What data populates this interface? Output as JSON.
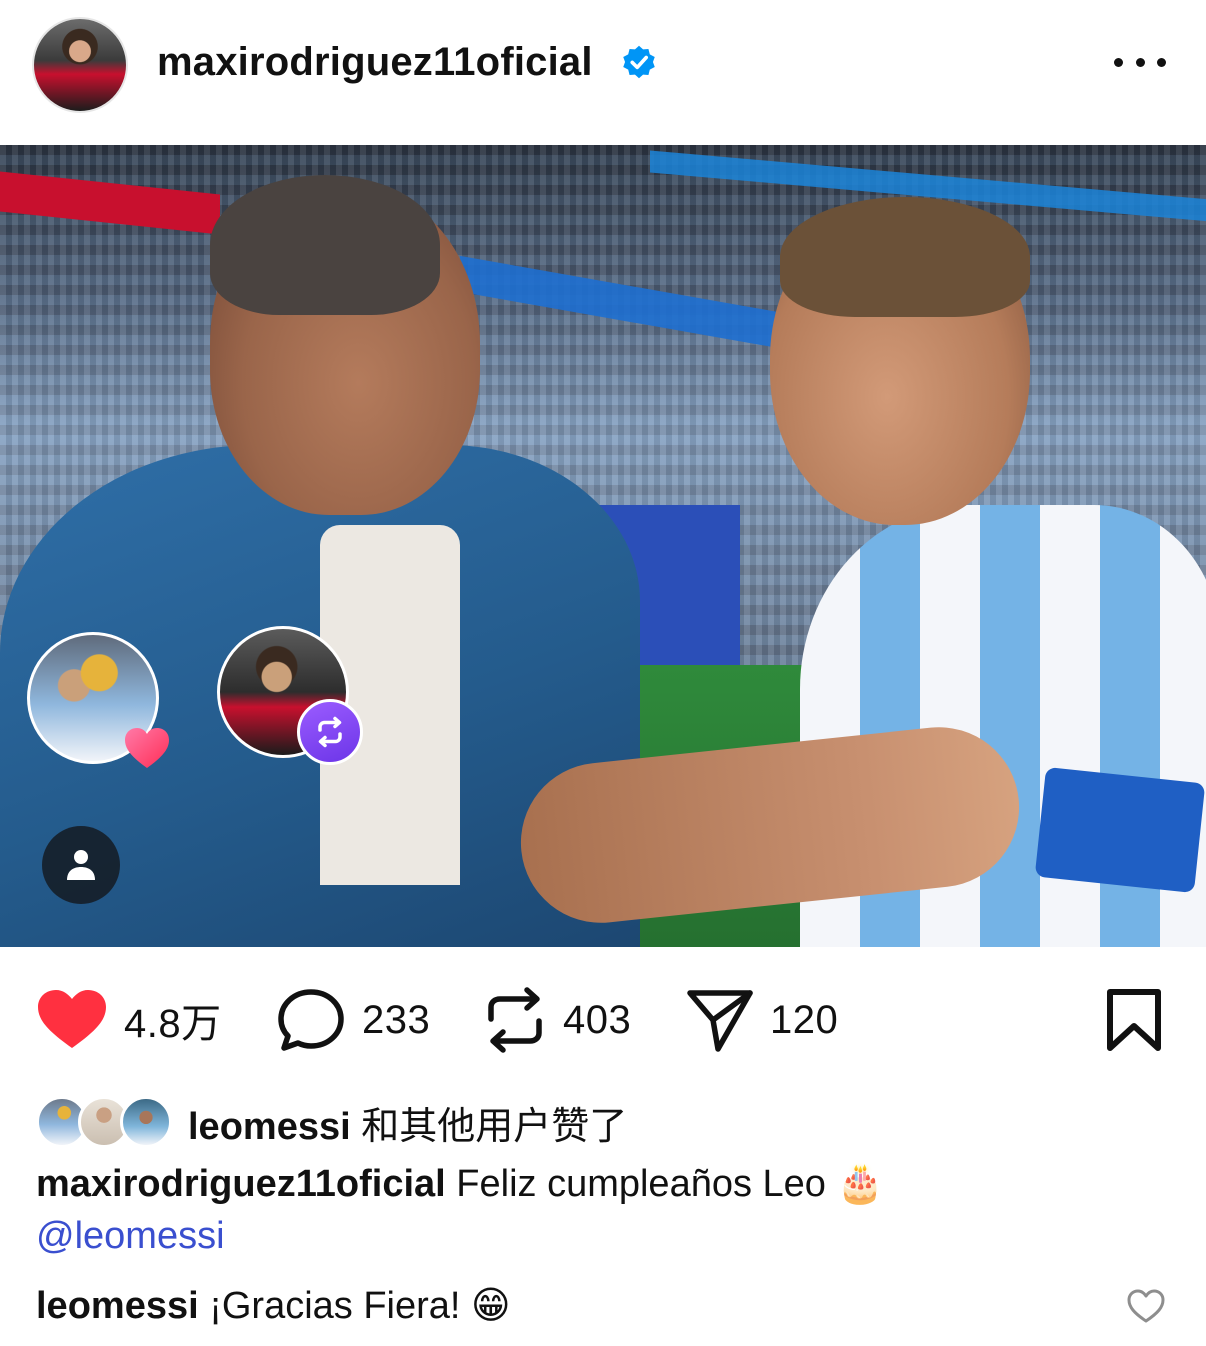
{
  "post": {
    "username": "maxirodriguez11oficial",
    "verified": true,
    "more_icon": "more-horizontal-icon"
  },
  "photo": {
    "tag_icon": "person-icon",
    "repost_icon": "repost-icon",
    "reaction_icon": "heart-icon"
  },
  "actions": {
    "likes": "4.8万",
    "comments": "233",
    "reposts": "403",
    "shares": "120"
  },
  "liked_by": {
    "user": "leomessi",
    "suffix": " 和其他用户赞了"
  },
  "caption": {
    "author": "maxirodriguez11oficial",
    "text": " Feliz cumpleaños Leo 🎂",
    "mention": "@leomessi"
  },
  "comment": {
    "author": "leomessi",
    "text": " ¡Gracias Fiera! 😁"
  },
  "colors": {
    "like_red": "#ff3040",
    "mention_blue": "#3a4fcf",
    "verified_blue": "#0095f6",
    "repost_purple": "#7b45f0"
  }
}
